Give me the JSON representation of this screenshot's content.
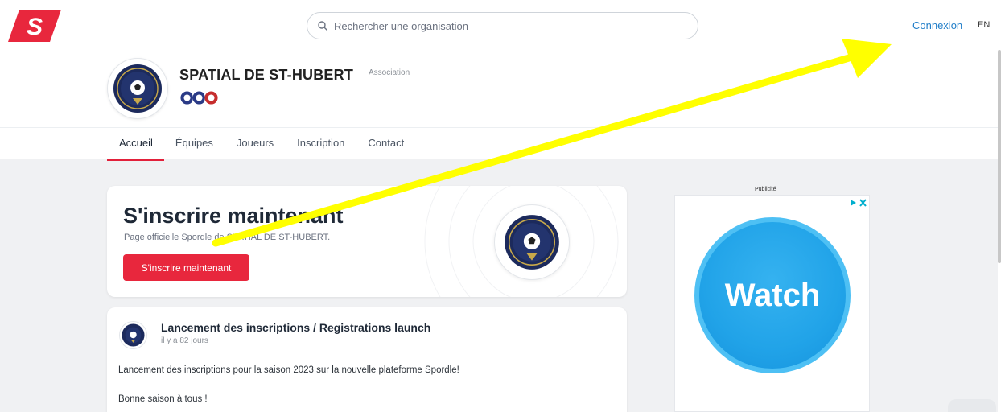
{
  "brand": {
    "accent": "#e8273d",
    "link": "#1f7dc8",
    "annotation_arrow": "#ffff00"
  },
  "header": {
    "logo_letter": "S",
    "search_placeholder": "Rechercher une organisation",
    "login_label": "Connexion",
    "language_label": "EN"
  },
  "org": {
    "name": "SPATIAL DE ST-HUBERT",
    "type": "Association",
    "badges": [
      "soccer-badge",
      "soccer-badge",
      "club-badge"
    ]
  },
  "tabs": [
    {
      "label": "Accueil",
      "active": true
    },
    {
      "label": "Équipes",
      "active": false
    },
    {
      "label": "Joueurs",
      "active": false
    },
    {
      "label": "Inscription",
      "active": false
    },
    {
      "label": "Contact",
      "active": false
    }
  ],
  "cta": {
    "title": "S'inscrire maintenant",
    "subtitle": "Page officielle Spordle de SPATIAL DE ST-HUBERT.",
    "button_label": "S'inscrire maintenant"
  },
  "post": {
    "title": "Lancement des inscriptions / Registrations launch",
    "time": "il y a 82 jours",
    "body_line1": "Lancement des inscriptions pour la saison 2023 sur la nouvelle plateforme Spordle!",
    "body_line2": "Bonne saison à tous !"
  },
  "ad": {
    "label": "Publicité",
    "text": "Watch"
  }
}
